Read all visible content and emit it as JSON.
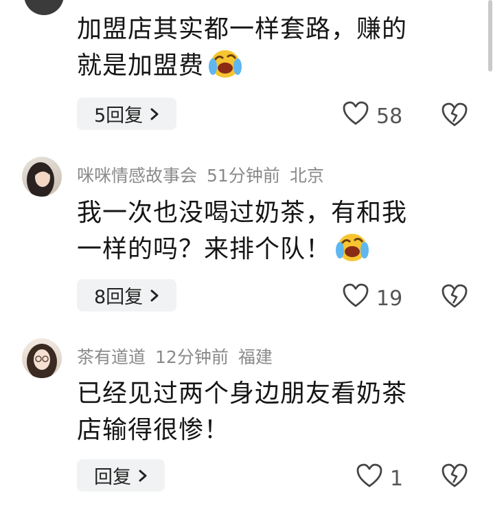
{
  "comments": [
    {
      "text_line1": "加盟店其实都一样套路，赚的",
      "text_line2": "就是加盟费",
      "emoji": "laughing-crying-emoji",
      "reply_label": "5回复",
      "likes": "58"
    },
    {
      "username": "咪咪情感故事会",
      "time": "51分钟前",
      "location": "北京",
      "text_line1": "我一次也没喝过奶茶，有和我",
      "text_line2": "一样的吗？来排个队！",
      "emoji": "laughing-crying-emoji",
      "reply_label": "8回复",
      "likes": "19"
    },
    {
      "username": "茶有道道",
      "time": "12分钟前",
      "location": "福建",
      "text_line1": "已经见过两个身边朋友看奶茶",
      "text_line2": "店输得很惨！",
      "reply_label": "回复",
      "likes": "1"
    }
  ],
  "icons": {
    "like": "heart-outline-icon",
    "dislike": "broken-heart-icon",
    "chevron": "chevron-right-icon"
  },
  "colors": {
    "meta_text": "#8a8a8a",
    "reply_bg": "#f1f2f3",
    "emoji_yellow": "#f7c531"
  }
}
